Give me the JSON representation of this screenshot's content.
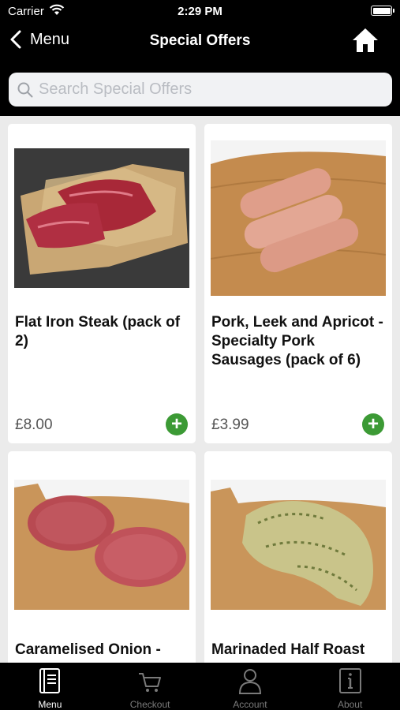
{
  "status": {
    "carrier": "Carrier",
    "time": "2:29 PM"
  },
  "nav": {
    "back_label": "Menu",
    "title": "Special Offers"
  },
  "search": {
    "placeholder": "Search Special Offers"
  },
  "products": [
    {
      "name": "Flat Iron Steak (pack of 2)",
      "price": "£8.00"
    },
    {
      "name": "Pork, Leek and Apricot - Specialty Pork Sausages (pack of 6)",
      "price": "£3.99"
    },
    {
      "name": "Caramelised Onion -",
      "price": ""
    },
    {
      "name": "Marinaded Half Roast",
      "price": ""
    }
  ],
  "tabs": [
    {
      "label": "Menu",
      "icon": "menu-book-icon",
      "active": true
    },
    {
      "label": "Checkout",
      "icon": "cart-icon",
      "active": false
    },
    {
      "label": "Account",
      "icon": "person-icon",
      "active": false
    },
    {
      "label": "About",
      "icon": "info-icon",
      "active": false
    }
  ],
  "colors": {
    "add_button": "#3c9a35",
    "bar": "#000000",
    "background": "#ebebeb"
  }
}
